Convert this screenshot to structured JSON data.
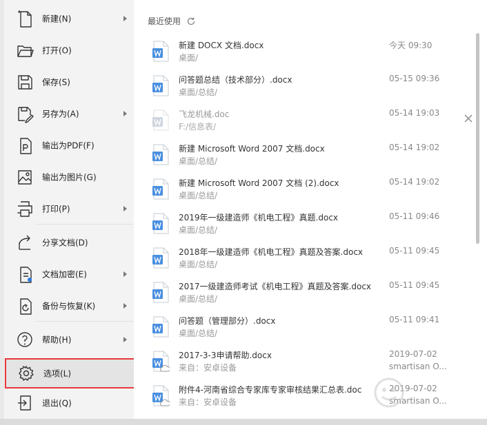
{
  "menu": {
    "items": [
      {
        "label": "新建(N)",
        "icon": "new-file-icon",
        "has_arrow": true
      },
      {
        "label": "打开(O)",
        "icon": "open-folder-icon",
        "has_arrow": false
      },
      {
        "label": "保存(S)",
        "icon": "save-icon",
        "has_arrow": false
      },
      {
        "label": "另存为(A)",
        "icon": "save-as-icon",
        "has_arrow": true
      },
      {
        "label": "输出为PDF(F)",
        "icon": "export-pdf-icon",
        "has_arrow": false
      },
      {
        "label": "输出为图片(G)",
        "icon": "export-image-icon",
        "has_arrow": false
      },
      {
        "label": "打印(P)",
        "icon": "printer-icon",
        "has_arrow": true
      },
      {
        "label": "分享文档(D)",
        "icon": "share-icon",
        "has_arrow": false
      },
      {
        "label": "文档加密(E)",
        "icon": "encrypt-icon",
        "has_arrow": true
      },
      {
        "label": "备份与恢复(K)",
        "icon": "backup-icon",
        "has_arrow": true
      },
      {
        "label": "帮助(H)",
        "icon": "help-icon",
        "has_arrow": true
      },
      {
        "label": "选项(L)",
        "icon": "gear-icon",
        "has_arrow": false,
        "selected": true
      },
      {
        "label": "退出(Q)",
        "icon": "exit-icon",
        "has_arrow": false
      }
    ]
  },
  "recent": {
    "title": "最近使用",
    "files": [
      {
        "name": "新建 DOCX 文档.docx",
        "path": "桌面/",
        "time": "今天 09:30",
        "owner": ""
      },
      {
        "name": "问答题总结（技术部分）.docx",
        "path": "桌面/总结/",
        "time": "05-15 09:36",
        "owner": ""
      },
      {
        "name": "飞龙机械.doc",
        "path": "F:/信息表/",
        "time": "05-14 19:03",
        "owner": "",
        "faded": true
      },
      {
        "name": "新建 Microsoft Word 2007 文档.docx",
        "path": "桌面/总结/",
        "time": "05-14 19:02",
        "owner": ""
      },
      {
        "name": "新建 Microsoft Word 2007 文档 (2).docx",
        "path": "桌面/总结/",
        "time": "05-14 19:02",
        "owner": ""
      },
      {
        "name": "2019年一级建造师《机电工程》真题.docx",
        "path": "桌面/总结/",
        "time": "05-11 09:46",
        "owner": ""
      },
      {
        "name": "2018年一级建造师《机电工程》真题及答案.docx",
        "path": "桌面/总结/",
        "time": "05-11 09:45",
        "owner": ""
      },
      {
        "name": "2017一级建造师考试《机电工程》真题及答案.docx",
        "path": "桌面/总结/",
        "time": "05-11 09:45",
        "owner": ""
      },
      {
        "name": "问答题（管理部分）.docx",
        "path": "桌面/总结/",
        "time": "05-11 09:41",
        "owner": ""
      },
      {
        "name": "2017-3-3申请帮助.docx",
        "path": "来自：安卓设备",
        "time": "2019-07-02",
        "owner": "smartisan O...",
        "cloud": true
      },
      {
        "name": "附件4-河南省综合专家库专家审核结果汇总表.doc",
        "path": "来自：安卓设备",
        "time": "2019-07-02",
        "owner": "smartisan O...",
        "cloud": true
      }
    ]
  },
  "colors": {
    "accent_red": "#e8373a",
    "word_blue": "#4a8fe0"
  }
}
